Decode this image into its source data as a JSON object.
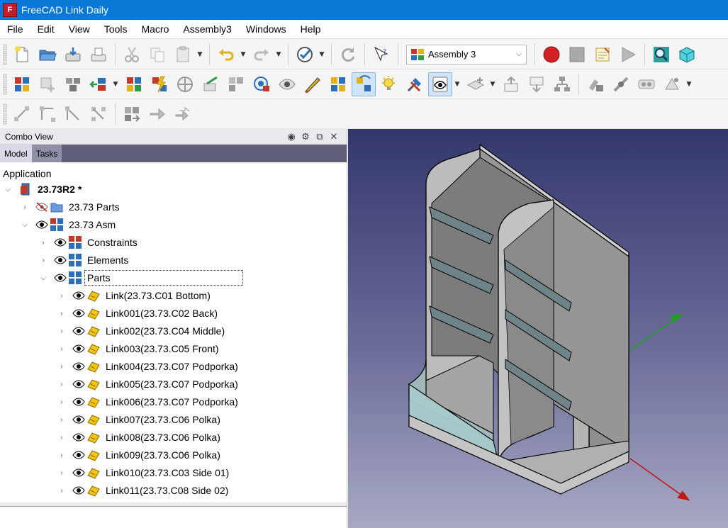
{
  "window": {
    "title": "FreeCAD Link Daily",
    "app_icon_letter": "F"
  },
  "menu": [
    "File",
    "Edit",
    "View",
    "Tools",
    "Macro",
    "Assembly3",
    "Windows",
    "Help"
  ],
  "workbench_selector": {
    "value": "Assembly 3"
  },
  "combo_view": {
    "title": "Combo View",
    "tabs": [
      "Model",
      "Tasks"
    ],
    "section_label": "Application"
  },
  "tree": {
    "document": "23.73R2 *",
    "items": [
      {
        "label": "23.73 Parts"
      },
      {
        "label": "23.73 Asm"
      },
      {
        "label": "Constraints"
      },
      {
        "label": "Elements"
      },
      {
        "label": "Parts"
      },
      {
        "label": "Link(23.73.C01 Bottom)"
      },
      {
        "label": "Link001(23.73.C02 Back)"
      },
      {
        "label": "Link002(23.73.C04 Middle)"
      },
      {
        "label": "Link003(23.73.C05 Front)"
      },
      {
        "label": "Link004(23.73.C07 Podporka)"
      },
      {
        "label": "Link005(23.73.C07 Podporka)"
      },
      {
        "label": "Link006(23.73.C07 Podporka)"
      },
      {
        "label": "Link007(23.73.C06 Polka)"
      },
      {
        "label": "Link008(23.73.C06 Polka)"
      },
      {
        "label": "Link009(23.73.C06 Polka)"
      },
      {
        "label": "Link010(23.73.C03 Side 01)"
      },
      {
        "label": "Link011(23.73.C08 Side 02)"
      }
    ]
  },
  "colors": {
    "title_bar": "#0a78d7",
    "viewport_top": "#34376c",
    "viewport_bottom": "#a7a9c4",
    "axis_y": "#1ea01e",
    "axis_x": "#c01818"
  }
}
